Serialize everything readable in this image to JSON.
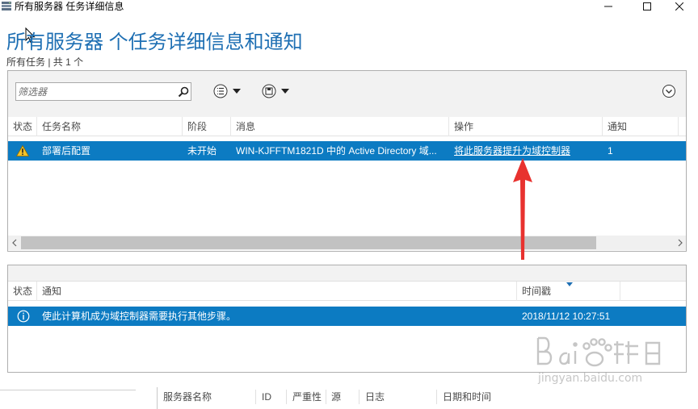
{
  "window": {
    "title": "所有服务器 任务详细信息",
    "icon": "server-manager-icon",
    "controls": [
      "minimize-icon",
      "maximize-icon",
      "close-icon"
    ]
  },
  "header": {
    "title": "所有服务器 个任务详细信息和通知",
    "breadcrumb": "所有任务 | 共 1 个"
  },
  "toolbar": {
    "filter_placeholder": "筛选器",
    "icons": [
      "search-icon",
      "list-view-icon",
      "save-query-icon",
      "expand-icon"
    ]
  },
  "tasks_table": {
    "columns": [
      "状态",
      "任务名称",
      "阶段",
      "消息",
      "操作",
      "通知"
    ],
    "rows": [
      {
        "status_icon": "warning-icon",
        "task_name": "部署后配置",
        "stage": "未开始",
        "message": "WIN-KJFFTM1821D 中的 Active Directory 域...",
        "action": "将此服务器提升为域控制器",
        "notification": "1"
      }
    ]
  },
  "notifications_table": {
    "columns": [
      "状态",
      "通知",
      "时间戳"
    ],
    "rows": [
      {
        "status_icon": "info-icon",
        "notification": "使此计算机成为域控制器需要执行其他步骤。",
        "timestamp": "2018/11/12 10:27:51"
      }
    ]
  },
  "bottom_columns": [
    "服务器名称",
    "ID",
    "严重性",
    "源",
    "日志",
    "日期和时间"
  ],
  "colors": {
    "title_blue": "#1e6fb3",
    "selection_blue": "#0c7bc2",
    "annotation_red": "#e8322f"
  }
}
